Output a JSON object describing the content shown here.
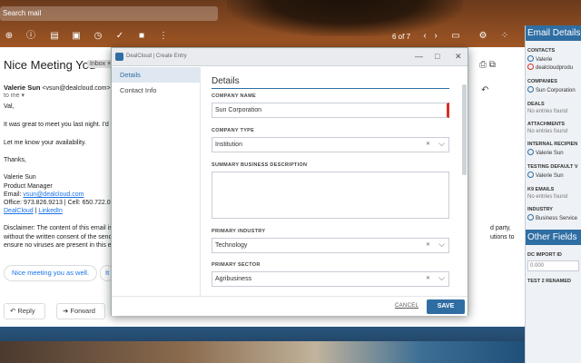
{
  "gmail": {
    "search_placeholder": "Search mail",
    "pager": "6 of 7",
    "subject": "Nice Meeting You",
    "inbox_badge": "Inbox ×",
    "sender_name": "Valerie Sun",
    "sender_email": "<vsun@dealcloud.com>",
    "to_me": "to me ▾",
    "greeting": "Val,",
    "line1": "It was great to meet you last night. I'd love",
    "line2": "Let me know your availability.",
    "thanks": "Thanks,",
    "sig_name": "Valerie Sun",
    "sig_title": "Product Manager",
    "sig_email_label": "Email:",
    "sig_email": "vsun@dealcloud.com",
    "sig_phone": "Office: 973.826.9213 | Cell: 650.722.0826",
    "sig_link1": "DealCloud",
    "sig_sep": "|",
    "sig_link2": "LinkedIn",
    "disclaimer1": "Disclaimer: The content of this email is co",
    "disclaimer2": "without the written consent of the sender.",
    "disclaimer3": "ensure no viruses are present in this emai",
    "right_text1": "d party,",
    "right_text2": "utions to",
    "smart_reply1": "Nice meeting you as well.",
    "smart_reply2": "It",
    "reply": "Reply",
    "forward": "Forward"
  },
  "panel": {
    "title": "Email Details",
    "contacts_label": "CONTACTS",
    "contact1": "Valerie",
    "contact2": "dealcloudprodu",
    "companies_label": "COMPANIES",
    "company1": "Sun Corporation",
    "deals_label": "DEALS",
    "deals_none": "No entries found",
    "attach_label": "ATTACHMENTS",
    "attach_none": "No entries found",
    "internal_label": "INTERNAL RECIPIEN",
    "internal1": "Valerie Sun",
    "testing_label": "TESTING DEFAULT V",
    "testing1": "Valerie Sun",
    "k9_label": "K9 EMAILS",
    "k9_none": "No entries found",
    "industry_label": "INDUSTRY",
    "industry1": "Business Service",
    "other_title": "Other Fields",
    "dc_import_label": "DC IMPORT ID",
    "dc_import_value": "0.000",
    "test2_label": "TEST 2 RENAMED"
  },
  "modal": {
    "title": "DealCloud | Create Entry",
    "nav": [
      {
        "label": "Details"
      },
      {
        "label": "Contact Info"
      }
    ],
    "section_title": "Details",
    "company_name_label": "COMPANY NAME",
    "company_name_value": "Sun Corporation",
    "company_type_label": "COMPANY TYPE",
    "company_type_value": "Institution",
    "summary_label": "SUMMARY BUSINESS DESCRIPTION",
    "primary_industry_label": "PRIMARY INDUSTRY",
    "primary_industry_value": "Technology",
    "primary_sector_label": "PRIMARY SECTOR",
    "primary_sector_value": "Agribusiness",
    "cancel": "CANCEL",
    "save": "SAVE"
  },
  "colors": {
    "accent": "#2f6ea3",
    "required": "#d93025",
    "link": "#1a73e8"
  }
}
